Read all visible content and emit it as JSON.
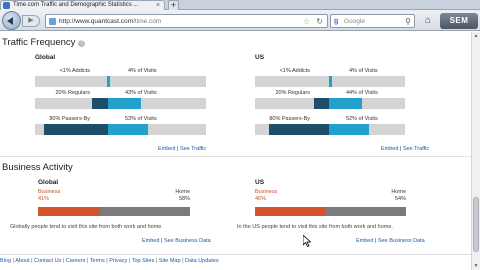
{
  "browser": {
    "tab_title": "Time.com Traffic and Demographic Statistics ...",
    "new_tab": "+",
    "url_domain": "http://www.quantcast.com",
    "url_path": "/time.com",
    "search_placeholder": "Google",
    "toolbar_badge": "SEM"
  },
  "traffic": {
    "title": "Traffic Frequency",
    "help": "?",
    "panels": [
      {
        "title": "Global",
        "rows": [
          {
            "label": "<1% Addicts",
            "value": "4% of Visits",
            "bar_start": 0.0,
            "bar_dark": 0.0,
            "bar_light": 0.02
          },
          {
            "label": "20% Regulars",
            "value": "43% of Visits",
            "bar_start": 0.0,
            "bar_dark": 0.2,
            "bar_light": 0.43
          },
          {
            "label": "80% Passers-By",
            "value": "53% of Visits",
            "bar_start": 0.0,
            "bar_dark": 0.8,
            "bar_light": 0.53
          }
        ],
        "links": {
          "embed": "Embed",
          "sep": "|",
          "see": "See Traffic"
        }
      },
      {
        "title": "US",
        "rows": [
          {
            "label": "<1% Addicts",
            "value": "4% of Visits",
            "bar_start": 0.0,
            "bar_dark": 0.0,
            "bar_light": 0.02
          },
          {
            "label": "20% Regulars",
            "value": "44% of Visits",
            "bar_start": 0.0,
            "bar_dark": 0.2,
            "bar_light": 0.44
          },
          {
            "label": "80% Passers-By",
            "value": "52% of Visits",
            "bar_start": 0.0,
            "bar_dark": 0.8,
            "bar_light": 0.52
          }
        ],
        "links": {
          "embed": "Embed",
          "sep": "|",
          "see": "See Traffic"
        }
      }
    ]
  },
  "business": {
    "title": "Business Activity",
    "panels": [
      {
        "title": "Global",
        "left_label": "Business",
        "left_pct": "41%",
        "right_label": "Home",
        "right_pct": "58%",
        "business_share": 0.41,
        "note": "Globally people tend to visit this site from both work and home.",
        "links": {
          "embed": "Embed",
          "sep": "|",
          "see": "See Business Data"
        }
      },
      {
        "title": "US",
        "left_label": "Business",
        "left_pct": "46%",
        "right_label": "Home",
        "right_pct": "54%",
        "business_share": 0.46,
        "note": "In the US people tend to visit this site from both work and home.",
        "links": {
          "embed": "Embed",
          "sep": "|",
          "see": "See Business Data"
        }
      }
    ]
  },
  "footer": {
    "items": [
      "Blog",
      "About",
      "Contact Us",
      "Careers",
      "Terms",
      "Privacy",
      "Top Sites",
      "Site Map",
      "Data Updates"
    ],
    "sep": "|"
  },
  "colors": {
    "frequent_dark": "#1f4e69",
    "frequent_light": "#21a1cc",
    "business_orange": "#d3552f",
    "home_gray": "#7b7b7b"
  }
}
